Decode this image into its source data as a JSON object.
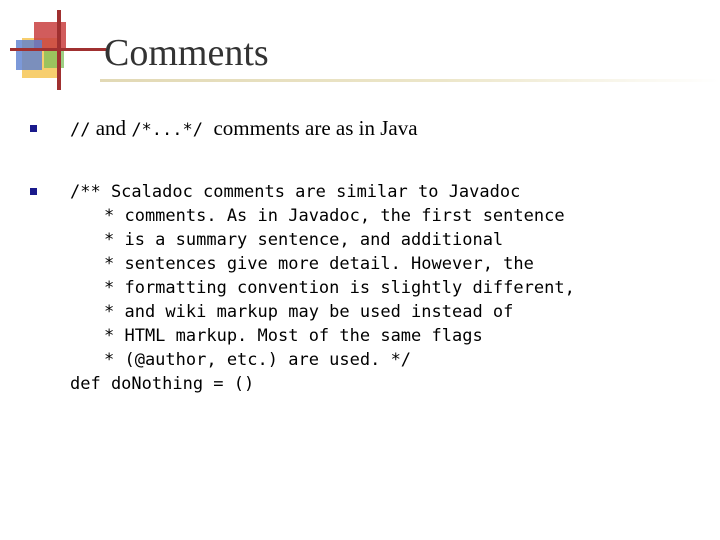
{
  "slide": {
    "title": "Comments",
    "bullet1": {
      "code1": "//",
      "text1": " and ",
      "code2": "/*...*/",
      "text2": "  comments are as in Java"
    },
    "bullet2": {
      "code_lines": [
        "/** Scaladoc comments are similar to Javadoc",
        "* comments. As in Javadoc, the first sentence",
        "* is a summary sentence, and additional",
        "* sentences give more detail. However, the",
        "* formatting convention is slightly different,",
        "* and wiki markup may be used instead of",
        "* HTML markup. Most of the same flags",
        "* (@author, etc.) are used. */",
        "def doNothing = ()"
      ]
    }
  },
  "colors": {
    "bullet": "#1a1a8c",
    "title": "#333333"
  },
  "icons": {
    "logo": "decorative-squares-logo-icon",
    "bullet": "square-bullet-icon"
  }
}
